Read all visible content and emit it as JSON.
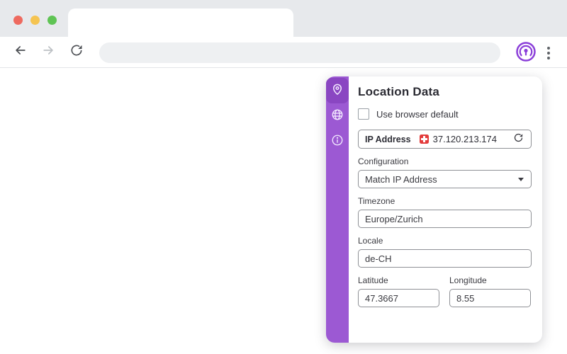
{
  "browser": {
    "url_value": ""
  },
  "popup": {
    "title": "Location Data",
    "default_checkbox": {
      "label": "Use browser default",
      "checked": false
    },
    "ip_row": {
      "label": "IP Address",
      "value": "37.120.213.174",
      "flag": "switzerland"
    },
    "fields": {
      "configuration": {
        "label": "Configuration",
        "value": "Match IP Address"
      },
      "timezone": {
        "label": "Timezone",
        "value": "Europe/Zurich"
      },
      "locale": {
        "label": "Locale",
        "value": "de-CH"
      },
      "latitude": {
        "label": "Latitude",
        "value": "47.3667"
      },
      "longitude": {
        "label": "Longitude",
        "value": "8.55"
      }
    },
    "sidebar_icons": [
      "location-pin",
      "globe",
      "info"
    ]
  },
  "colors": {
    "sidebar_purple": "#9c59d3",
    "sidebar_active": "#8a46c2",
    "accent_purple": "#8b3fd9",
    "flag_red": "#e33b3b",
    "tabstrip_gray": "#e7e9ec"
  }
}
